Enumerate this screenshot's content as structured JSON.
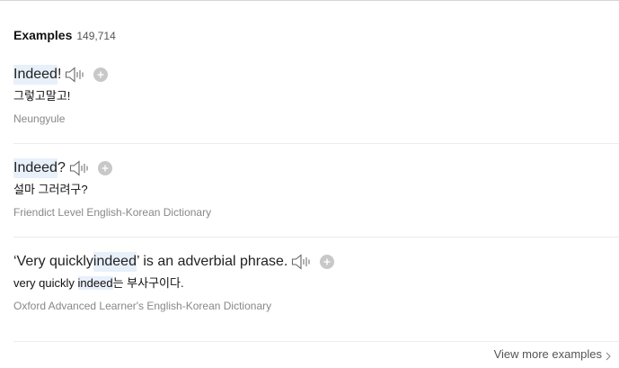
{
  "header": {
    "title": "Examples",
    "count": "149,714"
  },
  "examples": [
    {
      "sentence": {
        "before": "",
        "highlight": "Indeed",
        "after": "!"
      },
      "translation": {
        "before": "그렇고말고!",
        "highlight": "",
        "after": ""
      },
      "source": "Neungyule"
    },
    {
      "sentence": {
        "before": "",
        "highlight": "Indeed",
        "after": "?"
      },
      "translation": {
        "before": "설마 그러려구?",
        "highlight": "",
        "after": ""
      },
      "source": "Friendict Level English-Korean Dictionary"
    },
    {
      "sentence": {
        "before": "‘Very quickly ",
        "highlight": "indeed",
        "after": "’ is an adverbial phrase."
      },
      "translation": {
        "before": "very quickly ",
        "highlight": "indeed",
        "after": "는 부사구이다."
      },
      "source": "Oxford Advanced Learner's English-Korean Dictionary"
    }
  ],
  "footer": {
    "view_more": "View more examples"
  },
  "icons": {
    "speaker": "speaker-icon",
    "add": "add-icon",
    "chevron": "chevron-right-icon"
  },
  "colors": {
    "highlight": "#e8f0fa",
    "source_text": "#888888",
    "icon_gray": "#c8c8c8"
  }
}
